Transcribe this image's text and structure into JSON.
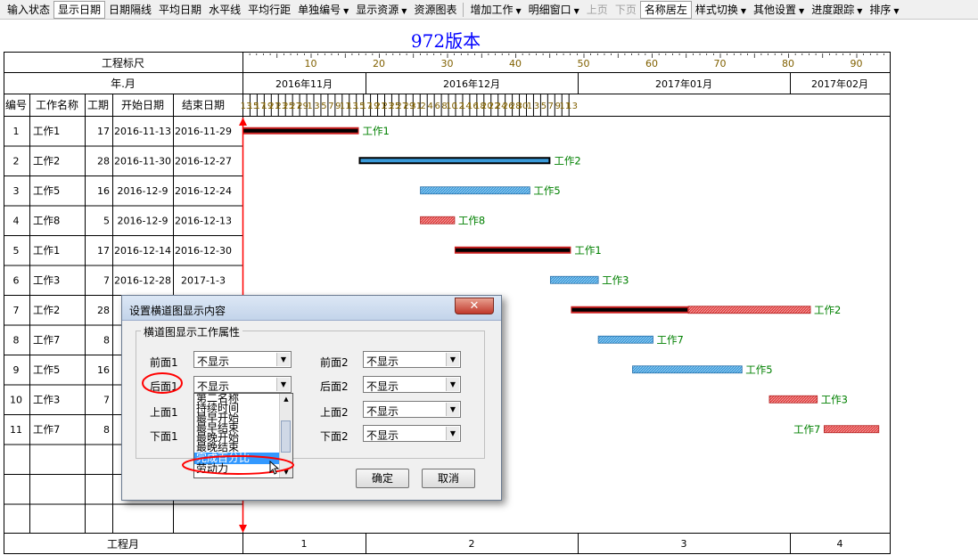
{
  "toolbar": {
    "items": [
      "输入状态",
      "显示日期",
      "日期隔线",
      "平均日期",
      "水平线",
      "平均行距",
      "单独编号",
      "显示资源",
      "资源图表",
      "增加工作",
      "明细窗口",
      "上页",
      "下页",
      "名称居左",
      "样式切换",
      "其他设置",
      "进度跟踪",
      "排序"
    ]
  },
  "title": "972版本",
  "header": {
    "ruler_label": "工程标尺",
    "year_month_label": "年.月",
    "ruler_ticks": [
      "10",
      "20",
      "30",
      "40",
      "50",
      "60",
      "70",
      "80",
      "90"
    ],
    "months": [
      "2016年11月",
      "2016年12月",
      "2017年01月",
      "2017年02月"
    ],
    "days": [
      "13",
      "15",
      "17",
      "19",
      "21",
      "23",
      "25",
      "27",
      "29",
      "1",
      "3",
      "5",
      "7",
      "9",
      "11",
      "13",
      "15",
      "17",
      "19",
      "21",
      "23",
      "25",
      "27",
      "29",
      "31",
      "2",
      "4",
      "6",
      "8",
      "10",
      "12",
      "14",
      "16",
      "18",
      "20",
      "22",
      "24",
      "26",
      "28",
      "30",
      "1",
      "3",
      "5",
      "7",
      "9",
      "11",
      "13"
    ],
    "columns": [
      "编号",
      "工作名称",
      "工期",
      "开始日期",
      "结束日期"
    ]
  },
  "rows": [
    {
      "no": "1",
      "name": "工作1",
      "dur": "17",
      "start": "2016-11-13",
      "end": "2016-11-29"
    },
    {
      "no": "2",
      "name": "工作2",
      "dur": "28",
      "start": "2016-11-30",
      "end": "2016-12-27"
    },
    {
      "no": "3",
      "name": "工作5",
      "dur": "16",
      "start": "2016-12-9",
      "end": "2016-12-24"
    },
    {
      "no": "4",
      "name": "工作8",
      "dur": "5",
      "start": "2016-12-9",
      "end": "2016-12-13"
    },
    {
      "no": "5",
      "name": "工作1",
      "dur": "17",
      "start": "2016-12-14",
      "end": "2016-12-30"
    },
    {
      "no": "6",
      "name": "工作3",
      "dur": "7",
      "start": "2016-12-28",
      "end": "2017-1-3"
    },
    {
      "no": "7",
      "name": "工作2",
      "dur": "28",
      "start": "2",
      "end": ""
    },
    {
      "no": "8",
      "name": "工作7",
      "dur": "8",
      "start": "",
      "end": ""
    },
    {
      "no": "9",
      "name": "工作5",
      "dur": "16",
      "start": "",
      "end": ""
    },
    {
      "no": "10",
      "name": "工作3",
      "dur": "7",
      "start": "2",
      "end": ""
    },
    {
      "no": "11",
      "name": "工作7",
      "dur": "8",
      "start": "",
      "end": ""
    }
  ],
  "bar_labels": [
    "工作1",
    "工作2",
    "工作5",
    "工作8",
    "工作1",
    "工作3",
    "工作2",
    "工作7",
    "工作5",
    "工作3",
    "工作7"
  ],
  "footer": {
    "label": "工程月",
    "months": [
      "1",
      "2",
      "3",
      "4"
    ]
  },
  "dialog": {
    "title": "设置横道图显示内容",
    "group_title": "横道图显示工作属性",
    "fields": {
      "front1": {
        "label": "前面1",
        "value": "不显示"
      },
      "back1": {
        "label": "后面1",
        "value": "不显示"
      },
      "top1": {
        "label": "上面1"
      },
      "bottom1": {
        "label": "下面1"
      },
      "front2": {
        "label": "前面2",
        "value": "不显示"
      },
      "back2": {
        "label": "后面2",
        "value": "不显示"
      },
      "top2": {
        "label": "上面2",
        "value": "不显示"
      },
      "bottom2": {
        "label": "下面2",
        "value": "不显示"
      }
    },
    "list_options": [
      "第二名称",
      "持续时间",
      "最早开始",
      "最早结束",
      "最晚开始",
      "最晚结束",
      "完成百分比",
      "劳动力"
    ],
    "list_selected": "完成百分比",
    "ok": "确定",
    "cancel": "取消"
  },
  "colors": {
    "critical": "#000000",
    "normal": "#3a9ad9",
    "free": "#e04040",
    "label": "#008000",
    "accent": "#0000ff"
  }
}
